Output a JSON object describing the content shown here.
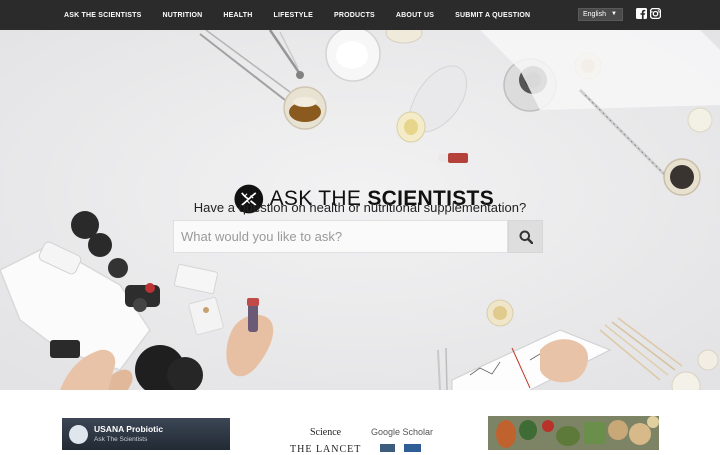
{
  "nav": {
    "links": [
      "ASK THE SCIENTISTS",
      "NUTRITION",
      "HEALTH",
      "LIFESTYLE",
      "PRODUCTS",
      "ABOUT US",
      "SUBMIT A QUESTION"
    ],
    "language": "English",
    "social_icons": [
      "facebook-icon",
      "instagram-icon"
    ]
  },
  "hero": {
    "brand_light": "ASK THE ",
    "brand_bold": "SCIENTISTS",
    "tagline": "Have a question on health or nutritional supplementation?",
    "search_placeholder": "What would you like to ask?",
    "search_icon": "search-icon"
  },
  "video": {
    "title": "USANA Probiotic",
    "channel": "Ask The Scientists"
  },
  "publications": {
    "science": "Science",
    "scholar": "Google Scholar",
    "lancet": "THE LANCET"
  },
  "colors": {
    "nav_bg": "#2b2b2b",
    "hero_bg": "#ececed",
    "search_button": "#dedede"
  }
}
